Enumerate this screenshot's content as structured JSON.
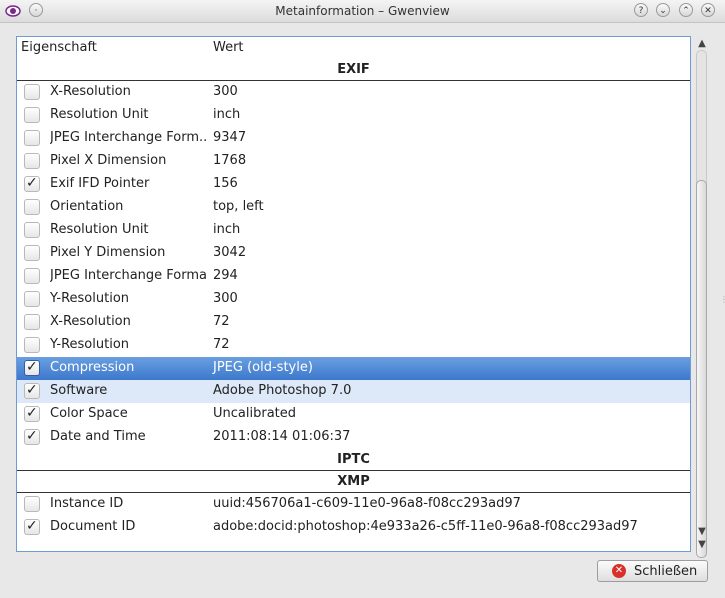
{
  "window": {
    "title": "Metainformation – Gwenview"
  },
  "titlebar_buttons": [
    "?",
    "⌄",
    "⌃",
    "✕"
  ],
  "table": {
    "columns": {
      "property": "Eigenschaft",
      "value": "Wert"
    },
    "sections": {
      "exif": "EXIF",
      "iptc": "IPTC",
      "xmp": "XMP"
    },
    "exif_rows": [
      {
        "name": "X-Resolution",
        "value": "300",
        "checked": false
      },
      {
        "name": "Resolution Unit",
        "value": "inch",
        "checked": false
      },
      {
        "name": "JPEG Interchange Form...",
        "value": "9347",
        "checked": false
      },
      {
        "name": "Pixel X Dimension",
        "value": "1768",
        "checked": false
      },
      {
        "name": "Exif IFD Pointer",
        "value": "156",
        "checked": true
      },
      {
        "name": "Orientation",
        "value": "top, left",
        "checked": false
      },
      {
        "name": "Resolution Unit",
        "value": "inch",
        "checked": false
      },
      {
        "name": "Pixel Y Dimension",
        "value": "3042",
        "checked": false
      },
      {
        "name": "JPEG Interchange Format",
        "value": "294",
        "checked": false
      },
      {
        "name": "Y-Resolution",
        "value": "300",
        "checked": false
      },
      {
        "name": "X-Resolution",
        "value": "72",
        "checked": false
      },
      {
        "name": "Y-Resolution",
        "value": "72",
        "checked": false
      },
      {
        "name": "Compression",
        "value": "JPEG (old-style)",
        "checked": true,
        "state": "selected"
      },
      {
        "name": "Software",
        "value": "Adobe Photoshop 7.0",
        "checked": true,
        "state": "hover"
      },
      {
        "name": "Color Space",
        "value": "Uncalibrated",
        "checked": true
      },
      {
        "name": "Date and Time",
        "value": "2011:08:14 01:06:37",
        "checked": true
      }
    ],
    "xmp_rows": [
      {
        "name": "Instance ID",
        "value": "uuid:456706a1-c609-11e0-96a8-f08cc293ad97",
        "checked": false
      },
      {
        "name": "Document ID",
        "value": "adobe:docid:photoshop:4e933a26-c5ff-11e0-96a8-f08cc293ad97",
        "checked": true
      }
    ]
  },
  "footer": {
    "close_label": "Schließen"
  },
  "colors": {
    "selection": "#3c78cc",
    "hover": "#dde9f8",
    "close_icon": "#d9302a"
  }
}
